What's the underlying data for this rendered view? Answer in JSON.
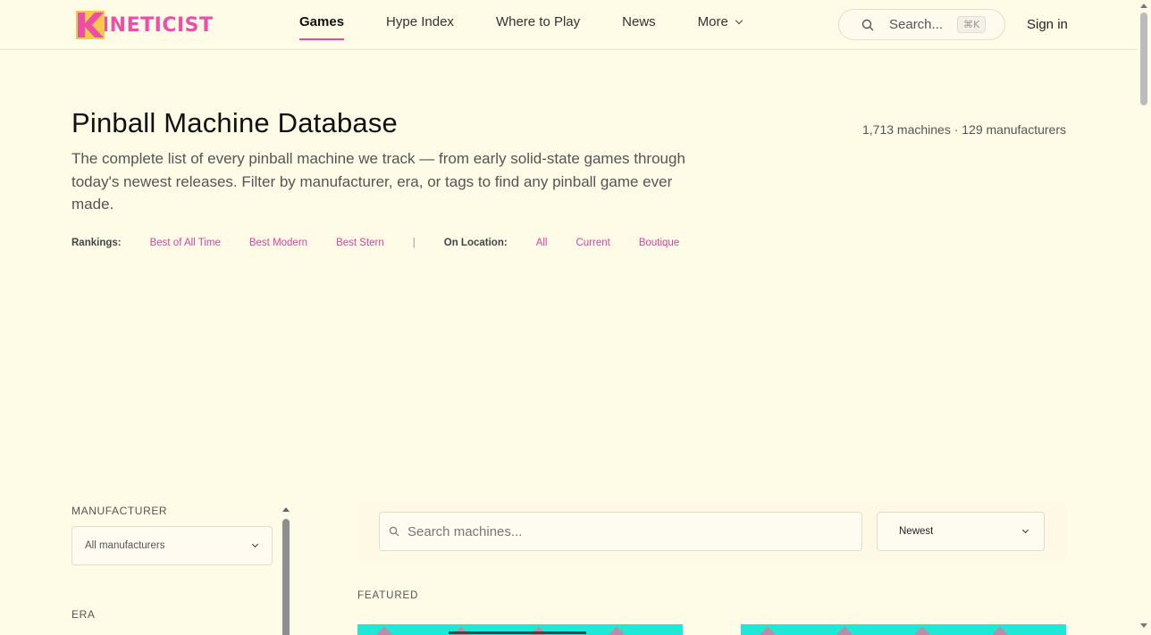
{
  "brand": {
    "logo_text": "INETICIST",
    "logo_letter": "K",
    "accent": "#e64aa0",
    "bg": "#fefbe6"
  },
  "nav": {
    "items": [
      {
        "label": "Games",
        "active": true
      },
      {
        "label": "Hype Index"
      },
      {
        "label": "Where to Play"
      },
      {
        "label": "News"
      },
      {
        "label": "More"
      }
    ],
    "search_placeholder": "Search...",
    "search_shortcut": "⌘K",
    "signin_label": "Sign in"
  },
  "hero": {
    "title": "Pinball Machine Database",
    "counts": "1,713 machines · 129 manufacturers",
    "description": "The complete list of every pinball machine we track — from early solid-state games through today's newest releases. Filter by manufacturer, era, or tags to find any pinball game ever made."
  },
  "rankings": {
    "label": "Rankings:",
    "links": [
      "Best of All Time",
      "Best Modern",
      "Best Stern"
    ],
    "separator": "|",
    "location_label": "On Location:",
    "location_links": [
      "All",
      "Current",
      "Boutique"
    ]
  },
  "sidebar": {
    "manufacturer_heading": "MANUFACTURER",
    "manufacturer_value": "All manufacturers",
    "era_heading": "ERA"
  },
  "main": {
    "search_placeholder": "Search machines...",
    "sort_value": "Newest",
    "featured_heading": "FEATURED"
  }
}
